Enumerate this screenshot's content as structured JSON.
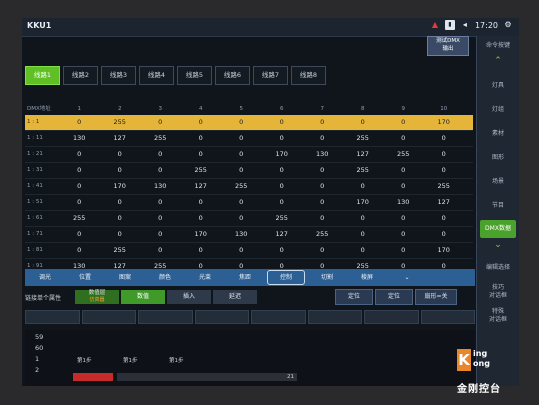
{
  "app": {
    "title": "KKU1",
    "time": "17:20"
  },
  "status_icons": [
    "warning-icon",
    "battery-icon",
    "gear-icon"
  ],
  "dmx_button": {
    "line1": "测试DMX",
    "line2": "输出"
  },
  "sidebar": {
    "items": [
      {
        "label": "命令按键"
      },
      {
        "label": "灯具"
      },
      {
        "label": "灯组"
      },
      {
        "label": "素材"
      },
      {
        "label": "图形"
      },
      {
        "label": "场景"
      },
      {
        "label": "节目"
      },
      {
        "label": "DMX数据"
      },
      {
        "label": "编辑选择"
      },
      {
        "label": "技巧\n对话框"
      },
      {
        "label": "特殊\n对话框"
      }
    ]
  },
  "tabs": [
    "线路1",
    "线路2",
    "线路3",
    "线路4",
    "线路5",
    "线路6",
    "线路7",
    "线路8"
  ],
  "grid": {
    "corner": "DMX地址",
    "columns": [
      "1",
      "2",
      "3",
      "4",
      "5",
      "6",
      "7",
      "8",
      "9",
      "10"
    ],
    "rows": [
      {
        "label": "1 : 1",
        "values": [
          "0",
          "255",
          "0",
          "0",
          "0",
          "0",
          "0",
          "0",
          "0",
          "170"
        ],
        "highlight": true
      },
      {
        "label": "1 : 11",
        "values": [
          "130",
          "127",
          "255",
          "0",
          "0",
          "0",
          "0",
          "255",
          "0",
          "0"
        ]
      },
      {
        "label": "1 : 21",
        "values": [
          "0",
          "0",
          "0",
          "0",
          "0",
          "170",
          "130",
          "127",
          "255",
          "0"
        ]
      },
      {
        "label": "1 : 31",
        "values": [
          "0",
          "0",
          "0",
          "255",
          "0",
          "0",
          "0",
          "255",
          "0",
          "0"
        ]
      },
      {
        "label": "1 : 41",
        "values": [
          "0",
          "170",
          "130",
          "127",
          "255",
          "0",
          "0",
          "0",
          "0",
          "255"
        ]
      },
      {
        "label": "1 : 51",
        "values": [
          "0",
          "0",
          "0",
          "0",
          "0",
          "0",
          "0",
          "170",
          "130",
          "127"
        ]
      },
      {
        "label": "1 : 61",
        "values": [
          "255",
          "0",
          "0",
          "0",
          "0",
          "255",
          "0",
          "0",
          "0",
          "0"
        ]
      },
      {
        "label": "1 : 71",
        "values": [
          "0",
          "0",
          "0",
          "170",
          "130",
          "127",
          "255",
          "0",
          "0",
          "0"
        ]
      },
      {
        "label": "1 : 81",
        "values": [
          "0",
          "255",
          "0",
          "0",
          "0",
          "0",
          "0",
          "0",
          "0",
          "170"
        ]
      },
      {
        "label": "1 : 91",
        "values": [
          "130",
          "127",
          "255",
          "0",
          "0",
          "0",
          "0",
          "255",
          "0",
          "0"
        ]
      }
    ]
  },
  "func_bar": {
    "items": [
      "调光",
      "位置",
      "图案",
      "颜色",
      "光束",
      "焦距",
      "控制",
      "切割",
      "棱屏"
    ],
    "selected": "控制"
  },
  "attr_row": {
    "label": "链接单个属性",
    "data_btn": {
      "label": "数值层",
      "sub": "仿真器"
    },
    "num_btn": "数值",
    "insert_btn": "插入",
    "delay_btn": "延迟",
    "pos1": "定位",
    "pos2": "定位",
    "scrn": "扇形=关"
  },
  "bottom": {
    "numbers": [
      "59",
      "60",
      "1",
      "2"
    ],
    "steps": [
      "第1步",
      "第1步",
      "第1步"
    ],
    "bottom_val": "21"
  },
  "logo": {
    "line1": "ing",
    "line2": "ong",
    "cn": "金刚控台"
  }
}
